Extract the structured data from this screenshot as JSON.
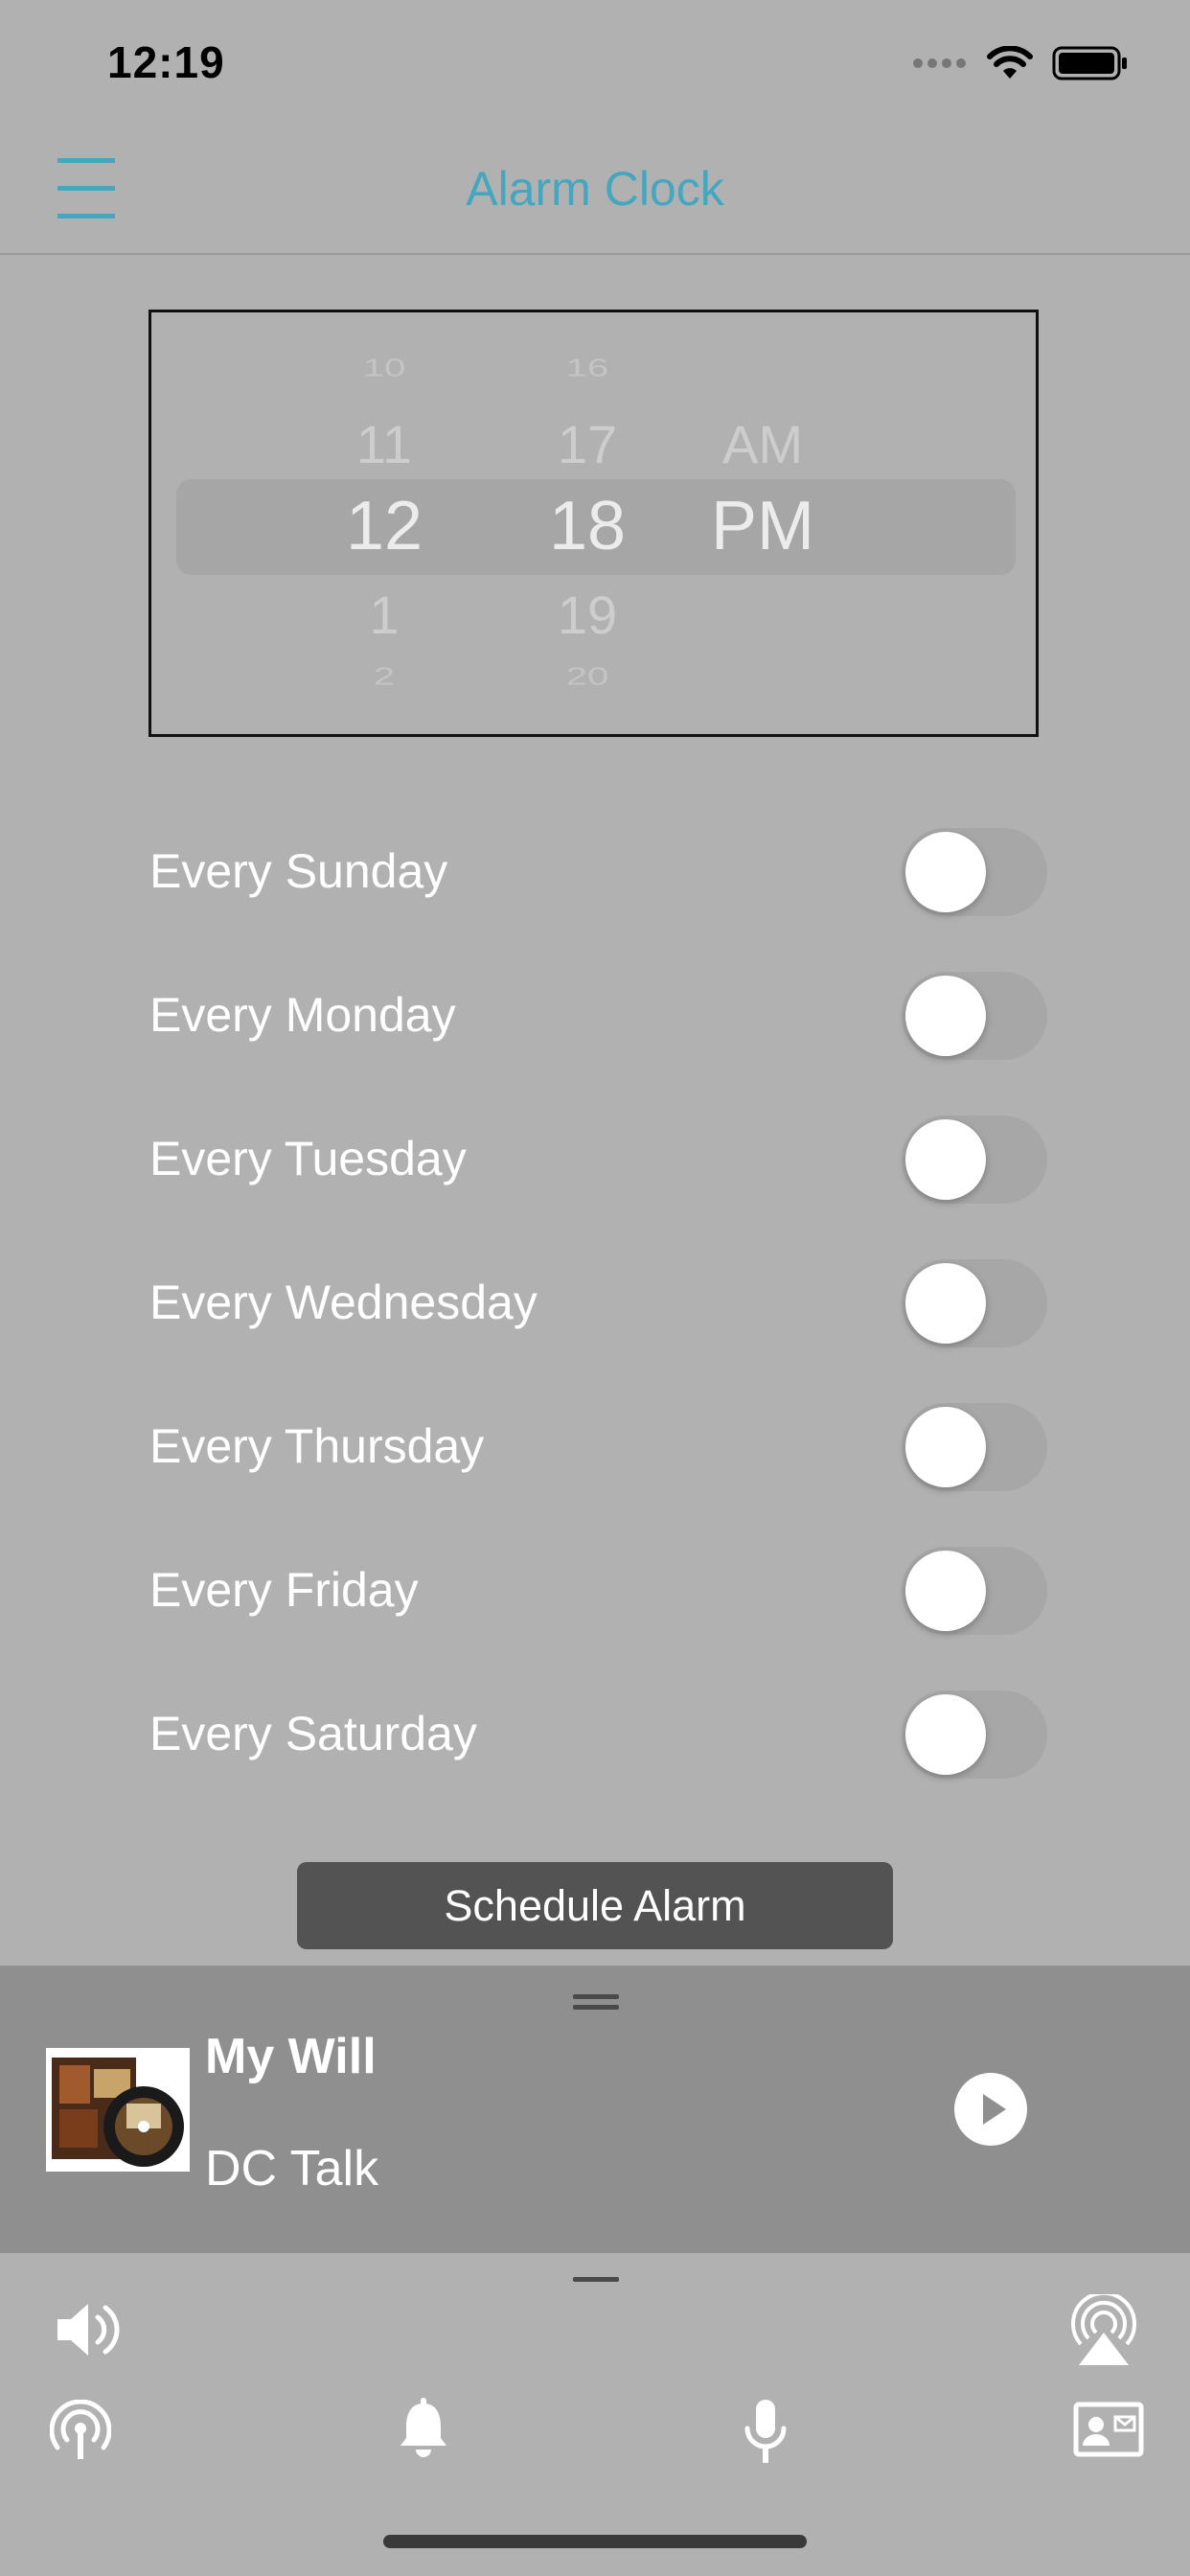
{
  "status_bar": {
    "time": "12:19"
  },
  "nav": {
    "title": "Alarm Clock"
  },
  "picker": {
    "hours": [
      "10",
      "11",
      "12",
      "1",
      "2"
    ],
    "minutes": [
      "16",
      "17",
      "18",
      "19",
      "20"
    ],
    "periods": [
      "AM",
      "PM"
    ]
  },
  "days": [
    {
      "label": "Every Sunday",
      "on": false
    },
    {
      "label": "Every Monday",
      "on": false
    },
    {
      "label": "Every Tuesday",
      "on": false
    },
    {
      "label": "Every Wednesday",
      "on": false
    },
    {
      "label": "Every Thursday",
      "on": false
    },
    {
      "label": "Every Friday",
      "on": false
    },
    {
      "label": "Every Saturday",
      "on": false
    }
  ],
  "schedule_button": "Schedule Alarm",
  "now_playing": {
    "title": "My Will",
    "artist": "DC Talk"
  },
  "colors": {
    "accent": "#45a7bf",
    "background": "#b1b1b1",
    "player": "#8f8f8f",
    "button": "#535353"
  }
}
